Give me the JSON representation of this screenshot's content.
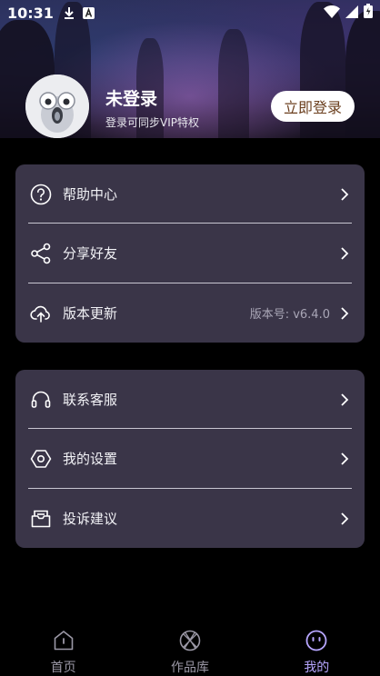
{
  "status_bar": {
    "time": "10:31"
  },
  "profile": {
    "name": "未登录",
    "subtitle": "登录可同步VIP特权",
    "login_button": "立即登录"
  },
  "menu_group_1": [
    {
      "label": "帮助中心",
      "icon": "question-circle-icon"
    },
    {
      "label": "分享好友",
      "icon": "share-icon"
    },
    {
      "label": "版本更新",
      "icon": "cloud-upload-icon",
      "value": "版本号: v6.4.0"
    }
  ],
  "menu_group_2": [
    {
      "label": "联系客服",
      "icon": "headset-icon"
    },
    {
      "label": "我的设置",
      "icon": "hexagon-settings-icon"
    },
    {
      "label": "投诉建议",
      "icon": "mail-envelope-icon"
    }
  ],
  "tabbar": {
    "active_index": 2,
    "items": [
      {
        "label": "首页",
        "icon": "home-icon"
      },
      {
        "label": "作品库",
        "icon": "library-icon"
      },
      {
        "label": "我的",
        "icon": "profile-face-icon"
      }
    ]
  },
  "colors": {
    "card_bg": "#3a3548",
    "accent": "#b7a6ff",
    "login_text": "#6b3f1e"
  }
}
